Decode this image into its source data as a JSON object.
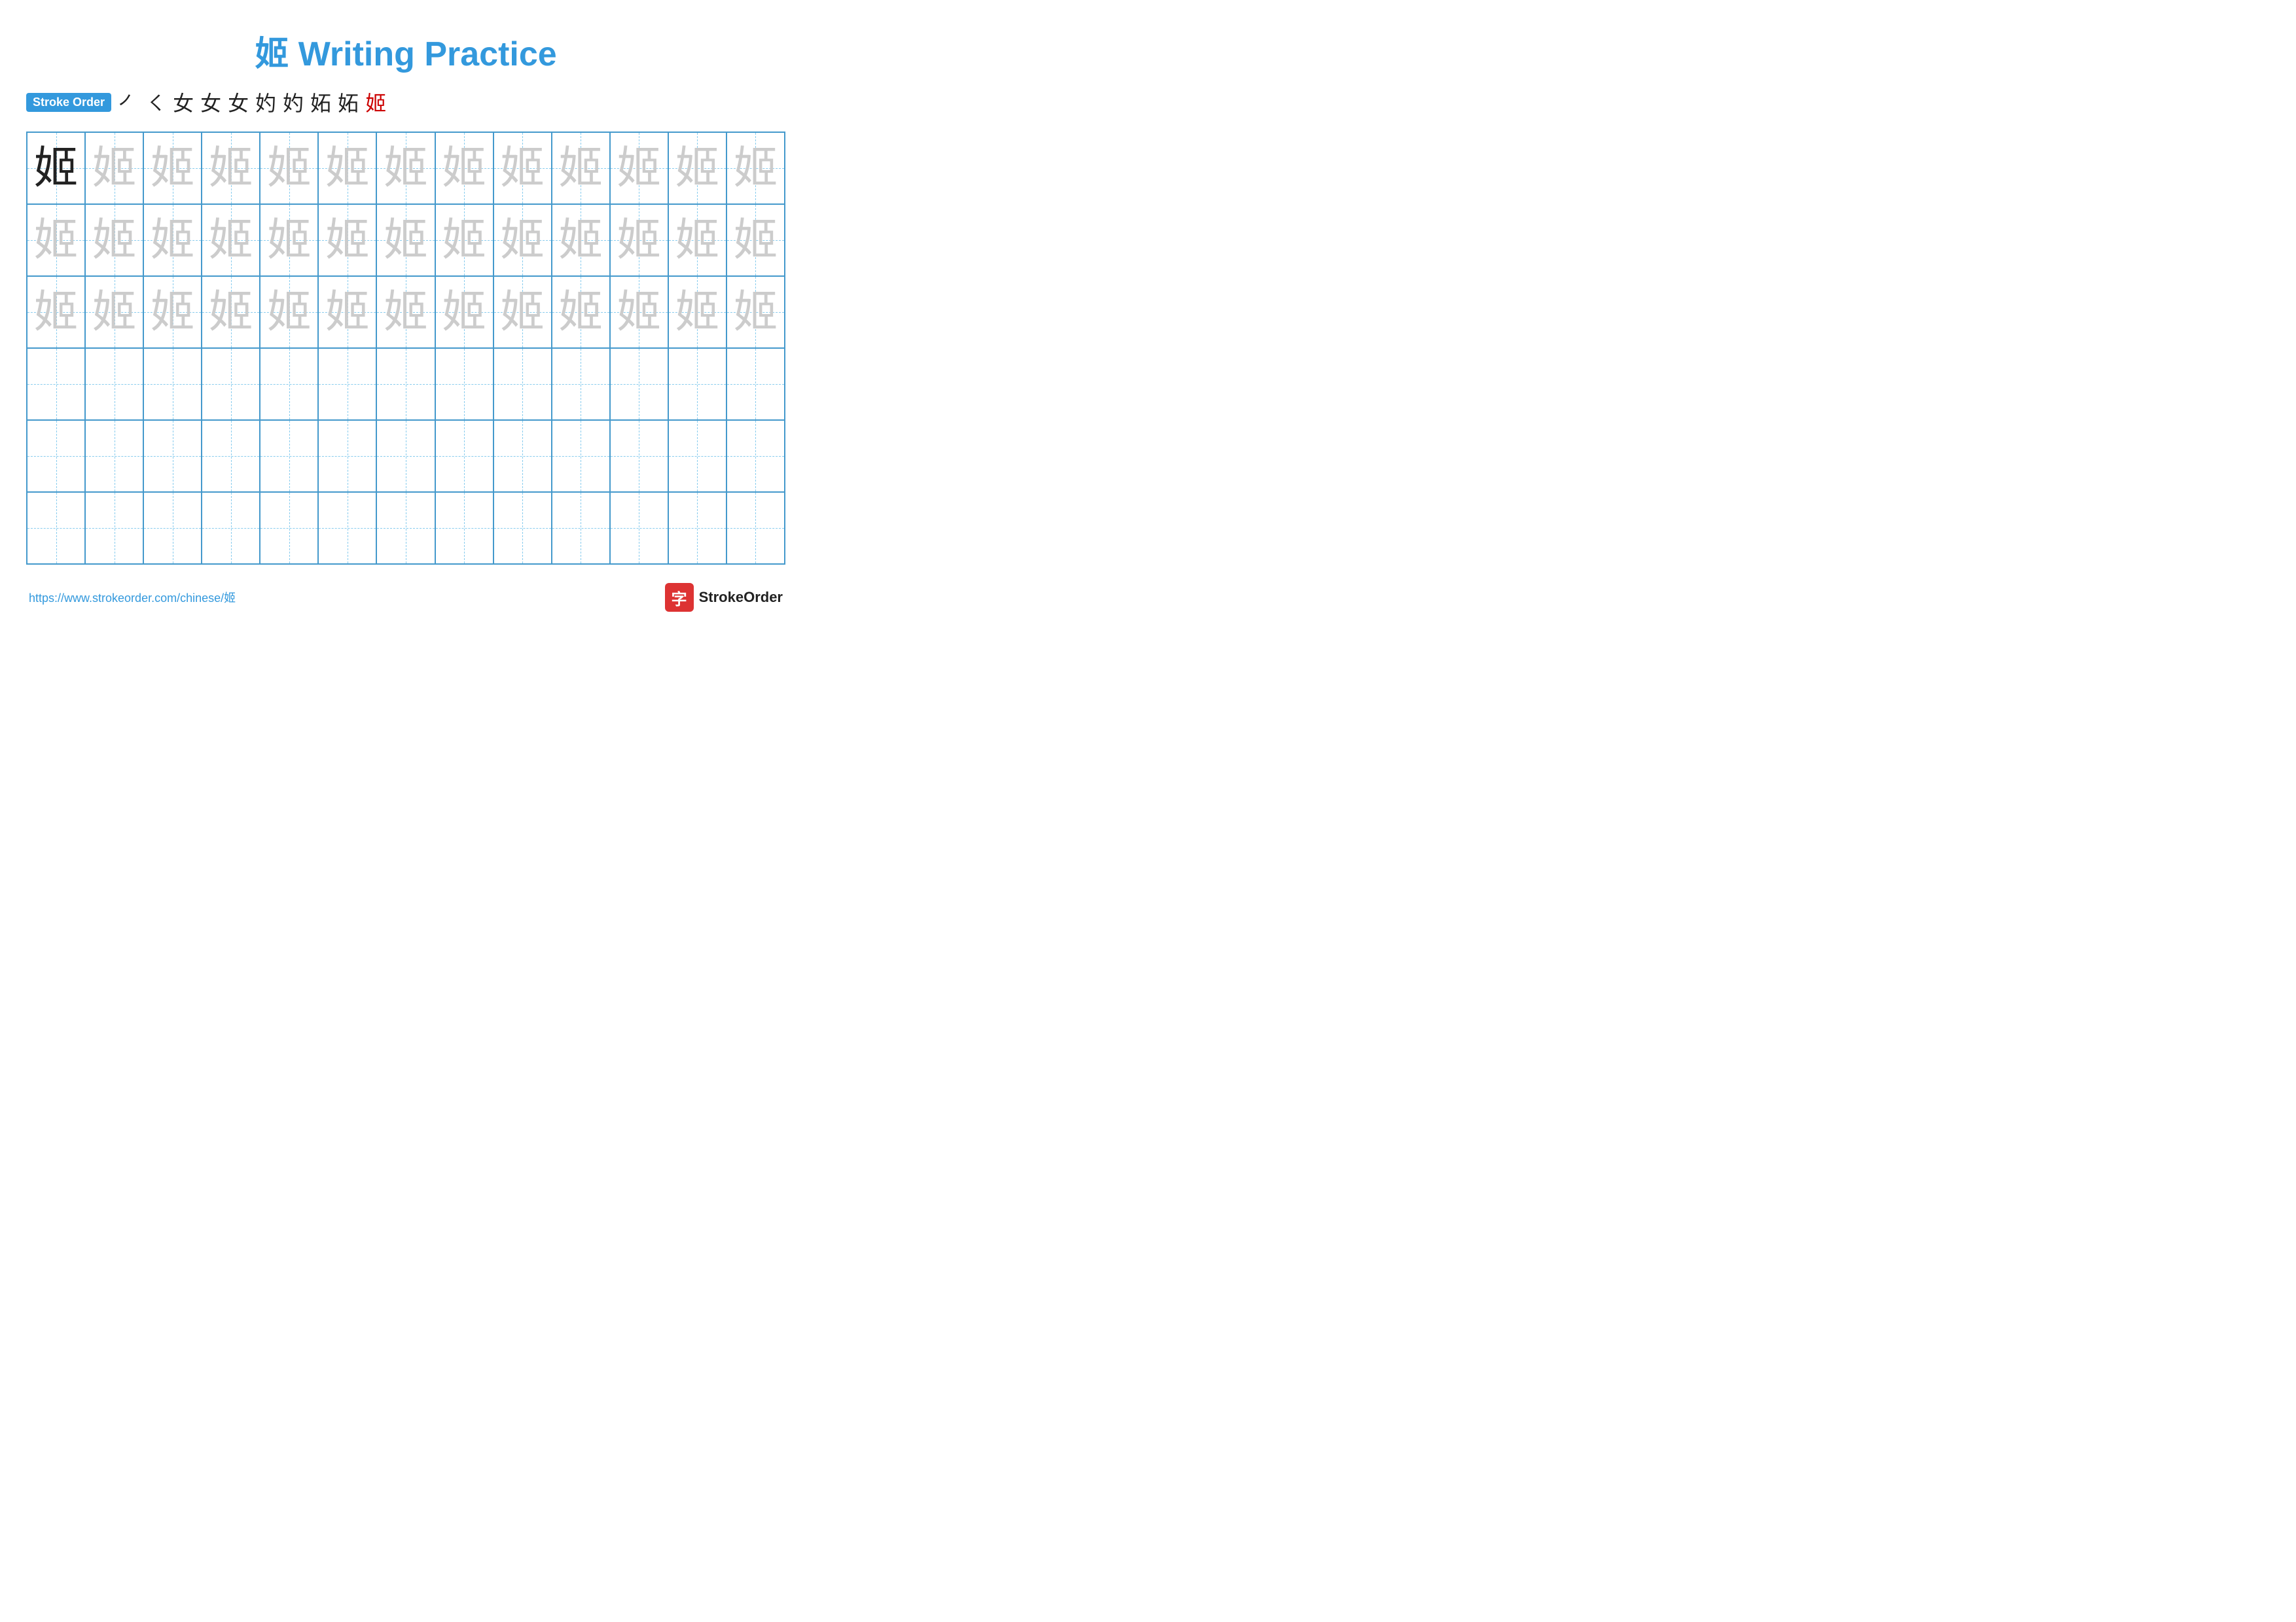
{
  "page": {
    "title": "姬 Writing Practice",
    "stroke_order_label": "Stroke Order",
    "stroke_steps": [
      "㇒",
      "㇛",
      "女",
      "女",
      "女",
      "奻",
      "奻",
      "妬",
      "妬",
      "姬"
    ],
    "stroke_steps_red_indices": [
      9
    ],
    "character": "姬",
    "grid_rows": 6,
    "grid_cols": 13,
    "url": "https://www.strokeorder.com/chinese/姬",
    "brand_name": "StrokeOrder",
    "brand_icon_char": "字"
  }
}
